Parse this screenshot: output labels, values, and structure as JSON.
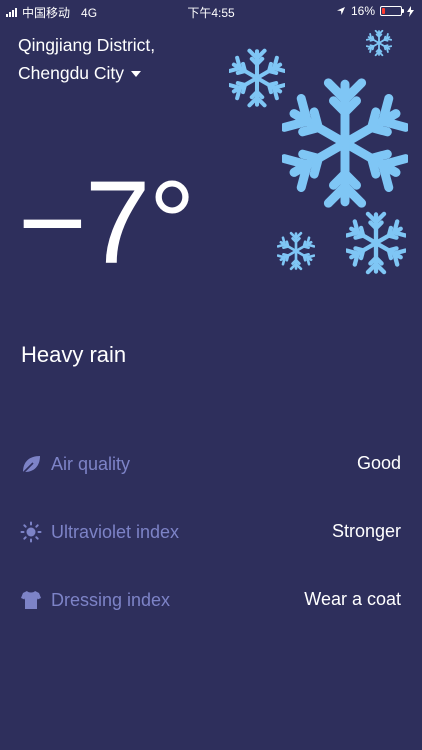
{
  "status_bar": {
    "carrier": "中国移动",
    "network": "4G",
    "time": "下午4:55",
    "battery_percent": "16%",
    "battery_level": 0.16
  },
  "location": {
    "line1": "Qingjiang District,",
    "line2": "Chengdu City"
  },
  "weather": {
    "temperature": "−7°",
    "condition": "Heavy rain",
    "snow_color": "#7fc6f5"
  },
  "indices": [
    {
      "icon": "leaf-icon",
      "label": "Air quality",
      "value": "Good"
    },
    {
      "icon": "sun-icon",
      "label": "Ultraviolet index",
      "value": "Stronger"
    },
    {
      "icon": "shirt-icon",
      "label": "Dressing index",
      "value": "Wear a coat"
    }
  ],
  "colors": {
    "background": "#2e2f5c",
    "label": "#7d83c7",
    "value": "#ffffff"
  }
}
